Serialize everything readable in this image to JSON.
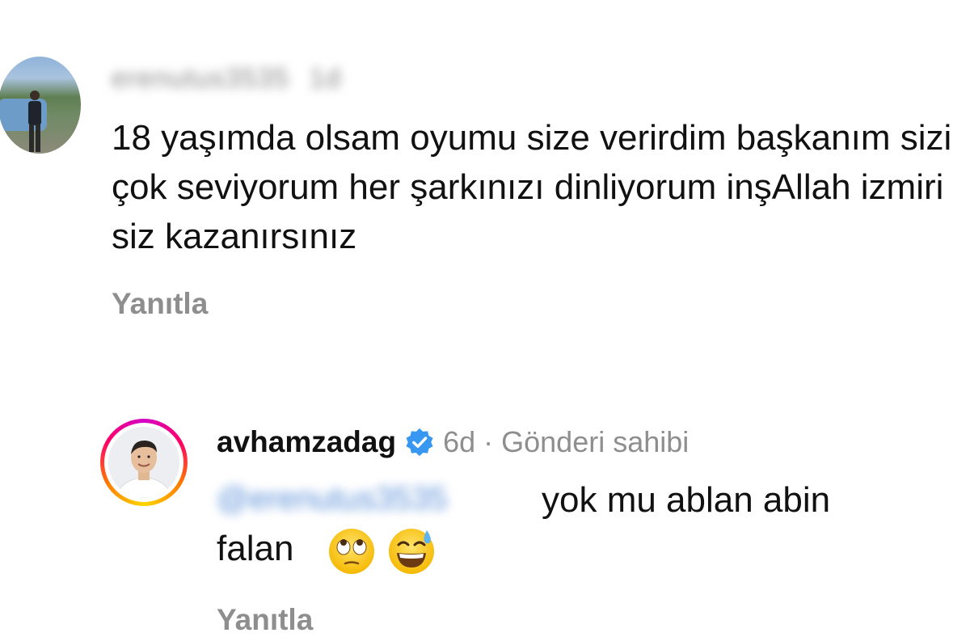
{
  "comments": [
    {
      "username": "erenutus3535",
      "time": "1d",
      "text": "18 yaşımda olsam oyumu size verirdim başkanım sizi çok seviyorum her şarkınızı dinliyorum inşAllah izmiri siz kazanırsınız",
      "reply_label": "Yanıtla"
    },
    {
      "username": "avhamzadag",
      "verified": true,
      "time": "6d",
      "separator": "·",
      "owner_label": "Gönderi sahibi",
      "mention": "@erenutus3535",
      "text_line1": "yok mu ablan abin",
      "text_line2": "falan",
      "emojis": [
        "face-with-rolling-eyes",
        "grinning-face-with-sweat"
      ],
      "reply_label": "Yanıtla"
    }
  ],
  "colors": {
    "secondary_text": "#8e8e8e",
    "mention": "#5a8fd8",
    "verified_badge": "#3897f0"
  }
}
